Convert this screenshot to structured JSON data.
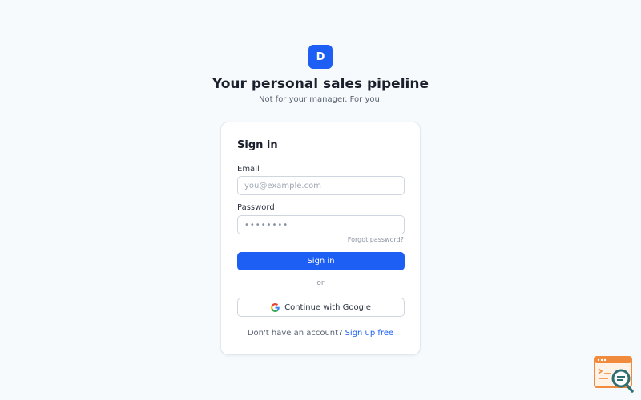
{
  "brand": {
    "logo_letter": "D",
    "headline": "Your personal sales pipeline",
    "tagline": "Not for your manager. For you."
  },
  "signin": {
    "title": "Sign in",
    "email_label": "Email",
    "email_placeholder": "you@example.com",
    "password_label": "Password",
    "password_placeholder": "••••••••",
    "forgot_password": "Forgot password?",
    "submit_label": "Sign in",
    "divider": "or",
    "google_label": "Continue with Google",
    "no_account_text": "Don't have an account?",
    "signup_link": "Sign up free"
  },
  "colors": {
    "accent": "#1d5ff5",
    "background": "#f7fafc",
    "card": "#ffffff",
    "border": "#cfd6df",
    "widget_accent": "#f08a3c",
    "widget_teal": "#2f6e73"
  },
  "icons": {
    "google": "google-g-icon",
    "corner_widget": "search-window-icon"
  }
}
